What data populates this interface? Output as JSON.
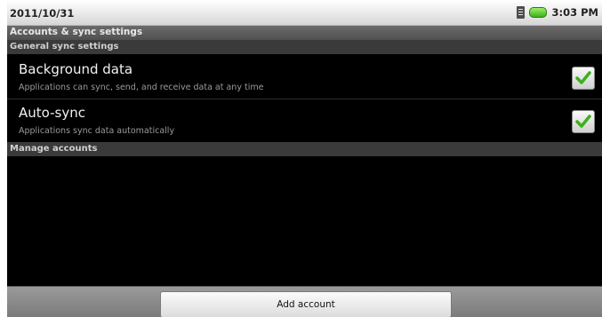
{
  "status_bar": {
    "date": "2011/10/31",
    "time": "3:03 PM",
    "icons": [
      "sim-signal-icon",
      "battery-icon"
    ]
  },
  "title": "Accounts & sync settings",
  "sections": {
    "general": "General sync settings",
    "manage": "Manage accounts"
  },
  "settings": [
    {
      "title": "Background data",
      "summary": "Applications can sync, send, and receive data at any time",
      "checked": true
    },
    {
      "title": "Auto-sync",
      "summary": "Applications sync data automatically",
      "checked": true
    }
  ],
  "buttons": {
    "add_account": "Add account"
  },
  "colors": {
    "check_green": "#3cb01b",
    "battery_green": "#5bd12a"
  }
}
